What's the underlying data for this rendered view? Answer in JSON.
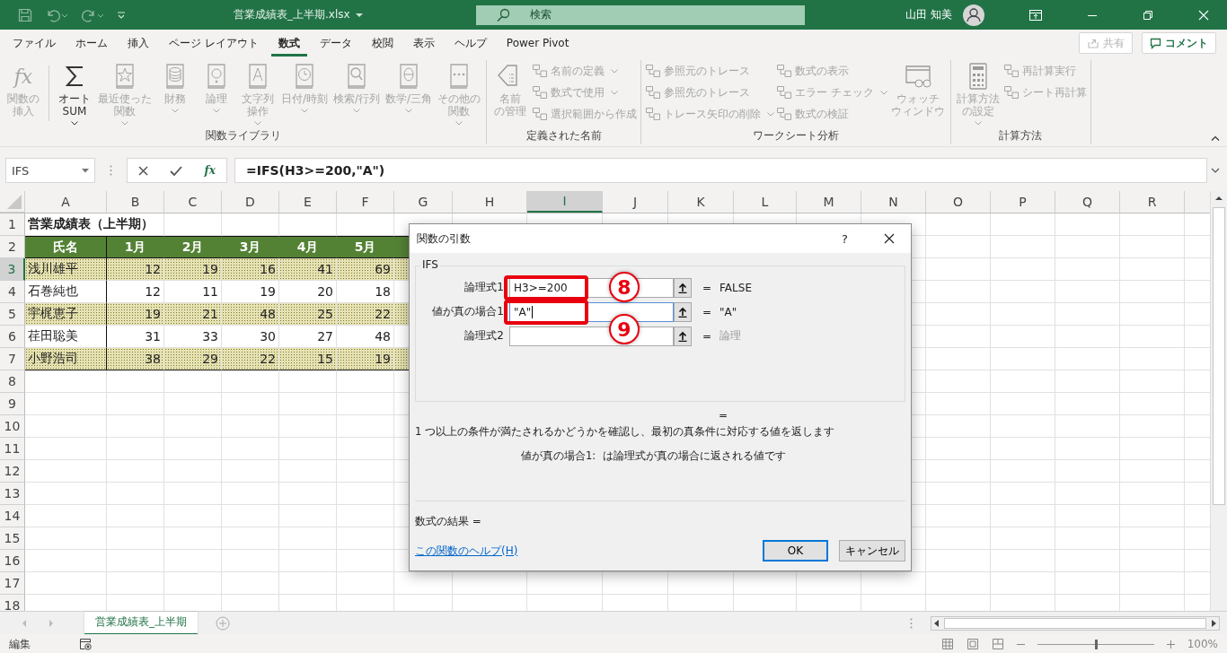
{
  "title_bar": {
    "file_name": "営業成績表_上半期.xlsx",
    "search_placeholder": "検索",
    "user_name": "山田 知美"
  },
  "ribbon_tabs": [
    {
      "label": "ファイル",
      "selected": false
    },
    {
      "label": "ホーム",
      "selected": false
    },
    {
      "label": "挿入",
      "selected": false
    },
    {
      "label": "ページ レイアウト",
      "selected": false
    },
    {
      "label": "数式",
      "selected": true
    },
    {
      "label": "データ",
      "selected": false
    },
    {
      "label": "校閲",
      "selected": false
    },
    {
      "label": "表示",
      "selected": false
    },
    {
      "label": "ヘルプ",
      "selected": false
    },
    {
      "label": "Power Pivot",
      "selected": false
    }
  ],
  "share_button": {
    "label": "共有",
    "disabled": true
  },
  "comment_button": {
    "label": "コメント"
  },
  "ribbon_groups": [
    {
      "label": "関数ライブラリ",
      "sections": [
        {
          "kind": "large",
          "lines": [
            "関数の",
            "挿入"
          ],
          "disabled": true,
          "dropdown": false,
          "icon_text": "fx"
        },
        {
          "kind": "large",
          "lines": [
            "オート",
            "SUM"
          ],
          "disabled": false,
          "dropdown": true
        },
        {
          "kind": "large",
          "lines": [
            "最近使った",
            "関数"
          ],
          "disabled": true,
          "dropdown": true
        },
        {
          "kind": "large",
          "lines": [
            "財務"
          ],
          "disabled": true,
          "dropdown": true
        },
        {
          "kind": "large",
          "lines": [
            "論理"
          ],
          "disabled": true,
          "dropdown": true
        },
        {
          "kind": "large",
          "lines": [
            "文字列",
            "操作"
          ],
          "disabled": true,
          "dropdown": true
        },
        {
          "kind": "large",
          "lines": [
            "日付/時刻"
          ],
          "disabled": true,
          "dropdown": true
        },
        {
          "kind": "large",
          "lines": [
            "検索/行列"
          ],
          "disabled": true,
          "dropdown": true
        },
        {
          "kind": "large",
          "lines": [
            "数学/三角"
          ],
          "disabled": true,
          "dropdown": true
        },
        {
          "kind": "large",
          "lines": [
            "その他の",
            "関数"
          ],
          "disabled": true,
          "dropdown": true
        }
      ]
    },
    {
      "label": "定義された名前",
      "sections": [
        {
          "kind": "large",
          "lines": [
            "名前",
            "の管理"
          ],
          "disabled": true,
          "dropdown": false
        },
        {
          "kind": "stack",
          "items": [
            {
              "label": "名前の定義",
              "disabled": true,
              "dropdown": true
            },
            {
              "label": "数式で使用",
              "disabled": true,
              "dropdown": true
            },
            {
              "label": "選択範囲から作成",
              "disabled": true,
              "dropdown": false
            }
          ]
        }
      ]
    },
    {
      "label": "ワークシート分析",
      "sections": [
        {
          "kind": "stack",
          "items": [
            {
              "label": "参照元のトレース",
              "disabled": true,
              "dropdown": false
            },
            {
              "label": "参照先のトレース",
              "disabled": true,
              "dropdown": false
            },
            {
              "label": "トレース矢印の削除",
              "disabled": true,
              "dropdown": true
            }
          ]
        },
        {
          "kind": "stack",
          "items": [
            {
              "label": "数式の表示",
              "disabled": true,
              "dropdown": false
            },
            {
              "label": "エラー チェック",
              "disabled": true,
              "dropdown": true
            },
            {
              "label": "数式の検証",
              "disabled": true,
              "dropdown": false
            }
          ]
        },
        {
          "kind": "large",
          "lines": [
            "ウォッチ",
            "ウィンドウ"
          ],
          "disabled": true,
          "dropdown": false
        }
      ]
    },
    {
      "label": "計算方法",
      "sections": [
        {
          "kind": "large",
          "lines": [
            "計算方法",
            "の設定"
          ],
          "disabled": true,
          "dropdown": true
        },
        {
          "kind": "stack",
          "items": [
            {
              "label": "再計算実行",
              "disabled": true,
              "dropdown": false
            },
            {
              "label": "シート再計算",
              "disabled": true,
              "dropdown": false
            }
          ]
        }
      ]
    }
  ],
  "formula_bar": {
    "name_box": "IFS",
    "fx_label": "fx",
    "formula": "=IFS(H3>=200,\"A\")"
  },
  "sheet": {
    "columns": [
      {
        "label": "A",
        "selected": false
      },
      {
        "label": "B",
        "selected": false
      },
      {
        "label": "C",
        "selected": false
      },
      {
        "label": "D",
        "selected": false
      },
      {
        "label": "E",
        "selected": false
      },
      {
        "label": "F",
        "selected": false
      },
      {
        "label": "G",
        "selected": false
      },
      {
        "label": "H",
        "selected": false
      },
      {
        "label": "I",
        "selected": true
      },
      {
        "label": "J",
        "selected": false
      },
      {
        "label": "K",
        "selected": false
      },
      {
        "label": "L",
        "selected": false
      },
      {
        "label": "M",
        "selected": false
      },
      {
        "label": "N",
        "selected": false
      },
      {
        "label": "O",
        "selected": false
      },
      {
        "label": "P",
        "selected": false
      },
      {
        "label": "Q",
        "selected": false
      },
      {
        "label": "R",
        "selected": false
      }
    ],
    "rows": [
      {
        "number": "1",
        "selected": false,
        "kind": "title",
        "title": "営業成績表（上半期）"
      },
      {
        "number": "2",
        "selected": false,
        "kind": "header",
        "cells": [
          "氏名",
          "1月",
          "2月",
          "3月",
          "4月",
          "5月"
        ]
      },
      {
        "number": "3",
        "selected": true,
        "kind": "data",
        "shaded": true,
        "name": "浅川雄平",
        "values": [
          "12",
          "19",
          "16",
          "41",
          "69"
        ]
      },
      {
        "number": "4",
        "selected": false,
        "kind": "data",
        "shaded": false,
        "name": "石巻純也",
        "values": [
          "12",
          "11",
          "19",
          "20",
          "18"
        ]
      },
      {
        "number": "5",
        "selected": false,
        "kind": "data",
        "shaded": true,
        "name": "宇梶恵子",
        "values": [
          "19",
          "21",
          "48",
          "25",
          "22"
        ]
      },
      {
        "number": "6",
        "selected": false,
        "kind": "data",
        "shaded": false,
        "name": "荏田聡美",
        "values": [
          "31",
          "33",
          "30",
          "27",
          "48"
        ]
      },
      {
        "number": "7",
        "selected": false,
        "kind": "data",
        "shaded": true,
        "name": "小野浩司",
        "values": [
          "38",
          "29",
          "22",
          "15",
          "19"
        ]
      },
      {
        "number": "8",
        "selected": false,
        "kind": "empty"
      },
      {
        "number": "9",
        "selected": false,
        "kind": "empty"
      },
      {
        "number": "10",
        "selected": false,
        "kind": "empty"
      },
      {
        "number": "11",
        "selected": false,
        "kind": "empty"
      },
      {
        "number": "12",
        "selected": false,
        "kind": "empty"
      },
      {
        "number": "13",
        "selected": false,
        "kind": "empty"
      },
      {
        "number": "14",
        "selected": false,
        "kind": "empty"
      },
      {
        "number": "15",
        "selected": false,
        "kind": "empty"
      },
      {
        "number": "16",
        "selected": false,
        "kind": "empty"
      },
      {
        "number": "17",
        "selected": false,
        "kind": "empty"
      },
      {
        "number": "18",
        "selected": false,
        "kind": "empty"
      }
    ]
  },
  "dialog": {
    "title": "関数の引数",
    "help": "?",
    "function_name": "IFS",
    "args": [
      {
        "label": "論理式1",
        "value": "H3>=200",
        "eq": "=",
        "result": "FALSE",
        "result_hint": false,
        "highlighted": true,
        "focused": false
      },
      {
        "label": "値が真の場合1",
        "value": "\"A\"",
        "eq": "=",
        "result": "\"A\"",
        "result_hint": false,
        "highlighted": true,
        "focused": true
      },
      {
        "label": "論理式2",
        "eq": "=",
        "result": "論理",
        "result_hint": true,
        "highlighted": false,
        "focused": false
      }
    ],
    "result_eq": "=",
    "description": "1 つ以上の条件が満たされるかどうかを確認し、最初の真条件に対応する値を返します",
    "arg_name": "値が真の場合1:",
    "arg_description": "は論理式が真の場合に返される値です",
    "formula_result_label": "数式の結果 =",
    "help_link": "この関数のヘルプ(H)",
    "buttons": [
      {
        "label": "OK",
        "default": true
      },
      {
        "label": "キャンセル",
        "default": false
      }
    ],
    "callouts": [
      {
        "label": "8"
      },
      {
        "label": "9"
      }
    ]
  },
  "sheet_tabs": [
    {
      "label": "営業成績表_上半期",
      "selected": true
    }
  ],
  "status_bar": {
    "mode": "編集",
    "zoom": {
      "level": 0.5
    },
    "zoom_label": "100%"
  }
}
